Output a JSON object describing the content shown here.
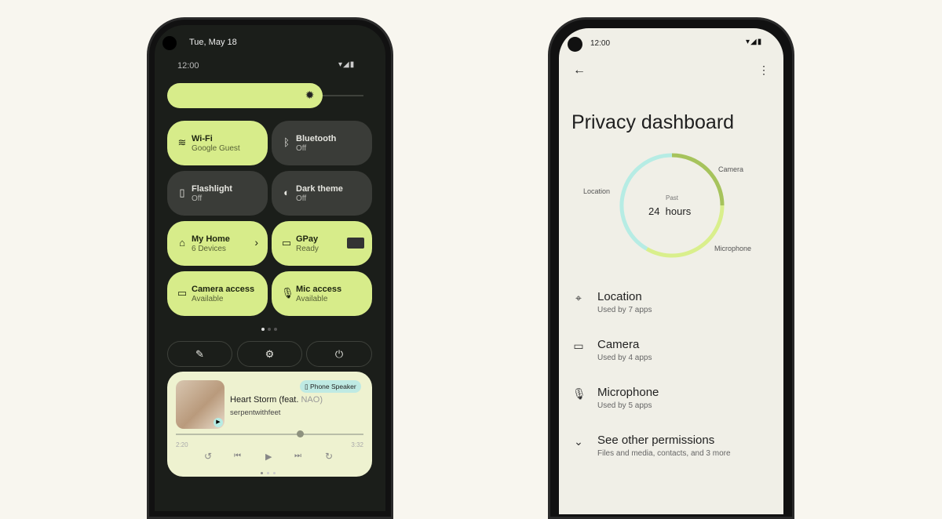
{
  "quick_settings": {
    "date": "Tue, May 18",
    "time": "12:00",
    "brightness_percent": 75,
    "tiles": [
      {
        "label": "Wi-Fi",
        "status": "Google Guest",
        "icon": "wifi-icon",
        "on": true
      },
      {
        "label": "Bluetooth",
        "status": "Off",
        "icon": "bluetooth-icon",
        "on": false
      },
      {
        "label": "Flashlight",
        "status": "Off",
        "icon": "flashlight-icon",
        "on": false
      },
      {
        "label": "Dark theme",
        "status": "Off",
        "icon": "dark-theme-icon",
        "on": false
      },
      {
        "label": "My Home",
        "status": "6 Devices",
        "icon": "home-icon",
        "on": true
      },
      {
        "label": "GPay",
        "status": "Ready",
        "icon": "wallet-icon",
        "on": true
      },
      {
        "label": "Camera access",
        "status": "Available",
        "icon": "camera-icon",
        "on": true
      },
      {
        "label": "Mic access",
        "status": "Available",
        "icon": "mic-icon",
        "on": true
      }
    ],
    "page": 1,
    "pages": 3,
    "media": {
      "output": "Phone Speaker",
      "title": "Heart Storm (feat. ",
      "title_feat": "NAO)",
      "artist": "serpentwithfeet",
      "elapsed": "2:20",
      "duration": "3:32",
      "progress_percent": 66
    }
  },
  "privacy": {
    "time": "12:00",
    "title": "Privacy dashboard",
    "ring": {
      "caption": "Past",
      "period": "24  hours",
      "segments": [
        {
          "label": "Camera",
          "color": "#a6c35c"
        },
        {
          "label": "Microphone",
          "color": "#d9ef8c"
        },
        {
          "label": "Location",
          "color": "#b6ece4"
        }
      ]
    },
    "items": [
      {
        "title": "Location",
        "subtitle": "Used by 7 apps",
        "icon": "location-pin-icon"
      },
      {
        "title": "Camera",
        "subtitle": "Used by 4 apps",
        "icon": "camera-icon"
      },
      {
        "title": "Microphone",
        "subtitle": "Used by 5 apps",
        "icon": "mic-icon"
      },
      {
        "title": "See other permissions",
        "subtitle": "Files and media, contacts, and 3 more",
        "icon": "chevron-down-icon"
      }
    ]
  },
  "colors": {
    "accent": "#d7ec8a",
    "background": "#f8f6ef",
    "dark_surface": "#1b1e1a"
  }
}
